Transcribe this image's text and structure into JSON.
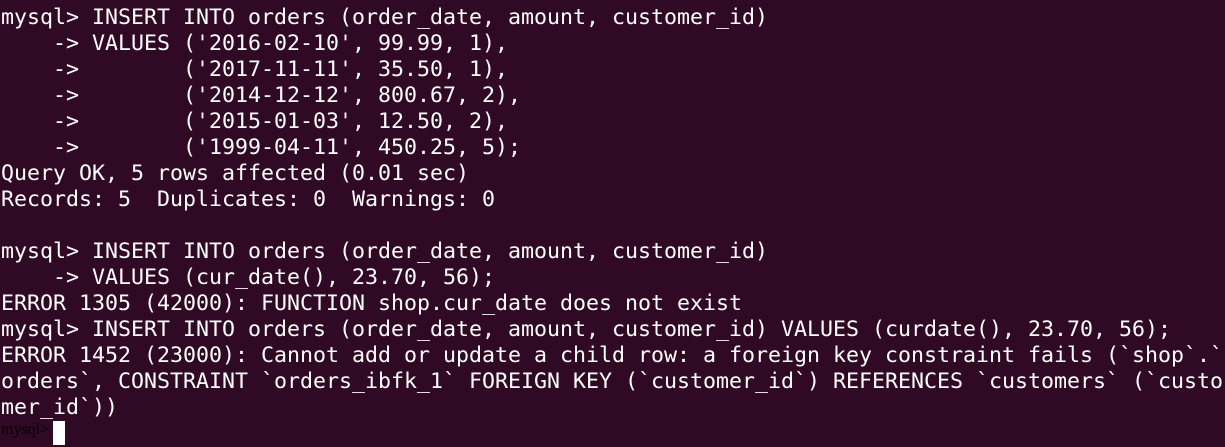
{
  "terminal": {
    "background": "#300a24",
    "foreground": "#ffffff",
    "lines": [
      "mysql> INSERT INTO orders (order_date, amount, customer_id)",
      "    -> VALUES ('2016-02-10', 99.99, 1),",
      "    ->        ('2017-11-11', 35.50, 1),",
      "    ->        ('2014-12-12', 800.67, 2),",
      "    ->        ('2015-01-03', 12.50, 2),",
      "    ->        ('1999-04-11', 450.25, 5);",
      "Query OK, 5 rows affected (0.01 sec)",
      "Records: 5  Duplicates: 0  Warnings: 0",
      "",
      "mysql> INSERT INTO orders (order_date, amount, customer_id)",
      "    -> VALUES (cur_date(), 23.70, 56);",
      "ERROR 1305 (42000): FUNCTION shop.cur_date does not exist",
      "mysql> INSERT INTO orders (order_date, amount, customer_id) VALUES (curdate(), 23.70, 56);",
      "ERROR 1452 (23000): Cannot add or update a child row: a foreign key constraint fails (`shop`.`",
      "orders`, CONSTRAINT `orders_ibfk_1` FOREIGN KEY (`customer_id`) REFERENCES `customers` (`custo",
      "mer_id`))"
    ],
    "prompt": "mysql> "
  }
}
